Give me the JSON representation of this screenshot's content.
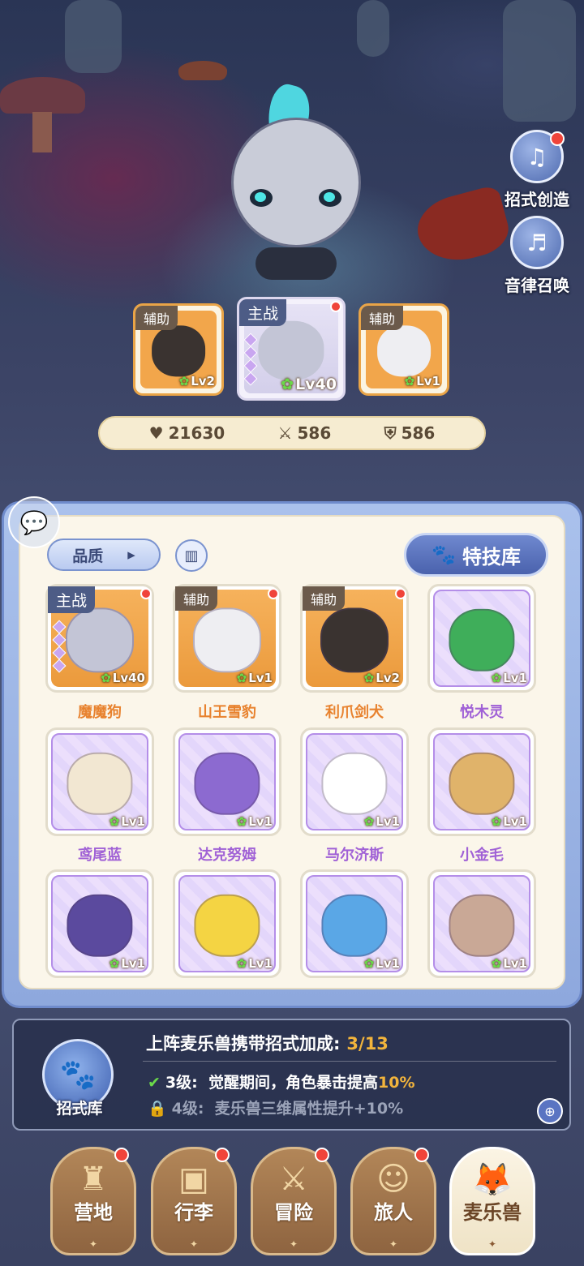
{
  "side_buttons": [
    {
      "label": "招式创造",
      "icon": "music-book-icon"
    },
    {
      "label": "音律召唤",
      "icon": "lyre-icon"
    }
  ],
  "team": [
    {
      "role": "辅助",
      "level": "Lv2",
      "name": "利爪剑犬"
    },
    {
      "role": "主战",
      "level": "Lv40",
      "name": "魔魔狗"
    },
    {
      "role": "辅助",
      "level": "Lv1",
      "name": "山王雪豹"
    }
  ],
  "stats": {
    "hp": "21630",
    "attack": "586",
    "defense": "586"
  },
  "filter": {
    "quality_label": "品质",
    "quality_arrow": "▸",
    "skill_library": "特技库"
  },
  "pets": [
    {
      "name": "魔魔狗",
      "role": "主战",
      "level": "Lv40",
      "rarity": "orange"
    },
    {
      "name": "山王雪豹",
      "role": "辅助",
      "level": "Lv1",
      "rarity": "orange"
    },
    {
      "name": "利爪剑犬",
      "role": "辅助",
      "level": "Lv2",
      "rarity": "orange"
    },
    {
      "name": "悦木灵",
      "role": "",
      "level": "Lv1",
      "rarity": "purple"
    },
    {
      "name": "鸢尾蓝",
      "role": "",
      "level": "Lv1",
      "rarity": "purple"
    },
    {
      "name": "达克努姆",
      "role": "",
      "level": "Lv1",
      "rarity": "purple"
    },
    {
      "name": "马尔济斯",
      "role": "",
      "level": "Lv1",
      "rarity": "purple"
    },
    {
      "name": "小金毛",
      "role": "",
      "level": "Lv1",
      "rarity": "purple"
    },
    {
      "name": "",
      "role": "",
      "level": "Lv1",
      "rarity": "purple"
    },
    {
      "name": "",
      "role": "",
      "level": "Lv1",
      "rarity": "purple"
    },
    {
      "name": "",
      "role": "",
      "level": "Lv1",
      "rarity": "purple"
    },
    {
      "name": "",
      "role": "",
      "level": "Lv1",
      "rarity": "purple"
    }
  ],
  "bonus": {
    "title": "上阵麦乐兽携带招式加成:",
    "count": "3/13",
    "icon_label": "招式库",
    "line1_level": "3级:",
    "line1_text": "觉醒期间，角色暴击提高",
    "line1_value": "10%",
    "line2_level": "4级:",
    "line2_text": "麦乐兽三维属性提升+10%"
  },
  "nav": [
    {
      "label": "营地",
      "icon": "castle-icon",
      "active": false
    },
    {
      "label": "行李",
      "icon": "backpack-icon",
      "active": false
    },
    {
      "label": "冒险",
      "icon": "crossed-swords-icon",
      "active": false
    },
    {
      "label": "旅人",
      "icon": "traveler-icon",
      "active": false
    },
    {
      "label": "麦乐兽",
      "icon": "pet-fox-icon",
      "active": true
    }
  ],
  "colors": {
    "accent_orange": "#e8822e",
    "accent_purple": "#a061d6",
    "highlight_gold": "#f2b43c",
    "notify_red": "#f0443a",
    "panel_blue": "#8ea8dd"
  }
}
